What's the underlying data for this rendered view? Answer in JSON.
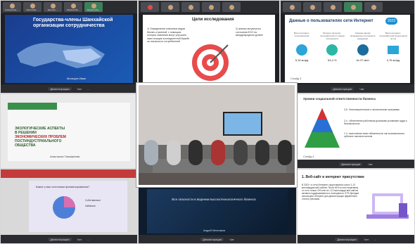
{
  "toolbar_names": [
    "Кашнилова ...",
    "Морозова ...",
    "Евгения ...",
    "Морзан Ма...",
    "Михаил Ма..."
  ],
  "panel1": {
    "title": "Государства-члены Шанхайской организации сотрудничества",
    "footer": "Мальцев Иван"
  },
  "panel2": {
    "title": "Цели исследования",
    "left_text": "1) Определение ключевых видов бизнес-стратегий, с помощью которых компании могут улучшить свои позиции в конкурентной борьбе за лояльность потребителей",
    "right_text": "2) анализ актуального состояния ЕСО на международном уровне"
  },
  "panel3": {
    "title": "Данные о пользователях сети Интернет",
    "year": "2023",
    "stats": [
      {
        "label": "Всего интернет-пользователей",
        "value": "5,16 млрд"
      },
      {
        "label": "Процент интернет-пользователей от общей численности",
        "value": "64,4 %"
      },
      {
        "label": "Среднее время проведенное в интернете ежедневно",
        "value": "6ч 37 мин"
      },
      {
        "label": "Всего интернет-пользователей электронной почты",
        "value": "4,76 млрд"
      }
    ],
    "footer": "Слайд 3"
  },
  "panel4": {
    "title_line1": "ЭКОЛОГИЧЕСКИЕ АСПЕКТЫ",
    "title_line2": "В РЕШЕНИИ",
    "title_line3": "ЭКОНОМИЧЕСКИХ ПРОБЛЕМ",
    "title_line4": "ПОСТИНДУСТРИАЛЬНОГО",
    "title_line5": "ОБЩЕСТВА",
    "author": "Анастасия Тимофеева"
  },
  "panel5": {
    "title": "Уровни социальной ответственности бизнеса",
    "items": [
      "3-5 - благотворительные и экологические программы",
      "2-4 - обеспечение работников должными условиями труда и безопасностью",
      "1-3 - выполнение своих обязательств, как экономического субъекта: выплата налогов"
    ],
    "footer": "Слайд 4"
  },
  "panel6": {
    "question": "Какие у вас источники финансирования?",
    "legend": [
      "Собственные",
      "Заёмные"
    ]
  },
  "panel7": {
    "text": "Все опасности в ведении высокотехнологичного бизнеса",
    "footer": "Андрей Мельников"
  },
  "panel8": {
    "title": "1. Веб-сайт и интернет присутствие",
    "body": "В 2023 г. в сети Интернет существовало около 1,13 миллиардов веб-сайтов. Почти 82% из них неактивны, то есть только 200 млн из 1,13 миллиарда веб-сайтов активно поддерживаются и посещаются. 97% брендов используют интернет для демонстрации фирменного стиля и рекламы."
  },
  "controls": {
    "demo": "Демонстрация",
    "chat": "Чат",
    "more": "..."
  }
}
